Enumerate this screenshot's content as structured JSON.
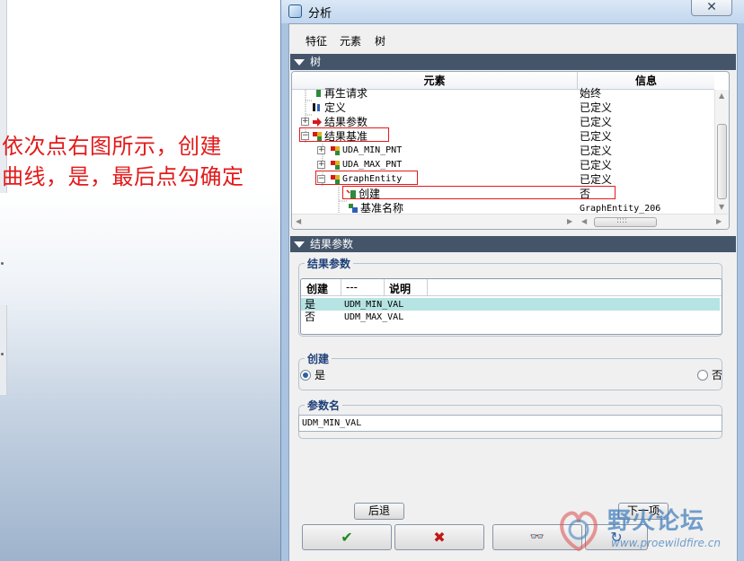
{
  "annotation": {
    "line1": "依次点右图所示，创建",
    "line2": "曲线，是，最后点勾确定"
  },
  "window": {
    "title": "分析",
    "close_glyph": "✕"
  },
  "menu": [
    "特征",
    "元素",
    "树"
  ],
  "tree_section": {
    "title": "树"
  },
  "tree": {
    "columns": [
      "元素",
      "信息"
    ],
    "rows": [
      {
        "name": "再生请求",
        "info": "始终"
      },
      {
        "name": "定义",
        "info": "已定义"
      },
      {
        "name": "结果参数",
        "info": "已定义"
      },
      {
        "name": "结果基准",
        "info": "已定义"
      },
      {
        "name": "UDA_MIN_PNT",
        "info": "已定义"
      },
      {
        "name": "UDA_MAX_PNT",
        "info": "已定义"
      },
      {
        "name": "GraphEntity",
        "info": "已定义"
      },
      {
        "name": "创建",
        "info": "否"
      },
      {
        "name": "基准名称",
        "info": "GraphEntity_206"
      }
    ],
    "expanders": [
      "+",
      "−",
      "+",
      "+",
      "−"
    ],
    "scroll_thumb_glyph": "::::"
  },
  "result_section": {
    "title": "结果参数"
  },
  "result_group": {
    "legend": "结果参数",
    "columns": [
      "创建",
      "---",
      "说明"
    ],
    "rows": [
      {
        "create": "是",
        "desc": "UDM_MIN_VAL"
      },
      {
        "create": "否",
        "desc": "UDM_MAX_VAL"
      }
    ]
  },
  "create_group": {
    "legend": "创建",
    "yes": "是",
    "no": "否",
    "selected": "是"
  },
  "param_group": {
    "legend": "参数名",
    "value": "UDM_MIN_VAL"
  },
  "buttons": {
    "back": "后退",
    "next": "下一项",
    "ok": "✔",
    "cancel": "✖",
    "preview": "👓",
    "refresh": "↻"
  },
  "watermark": {
    "text": "野火论坛",
    "url": "www.proewildfire.cn"
  }
}
